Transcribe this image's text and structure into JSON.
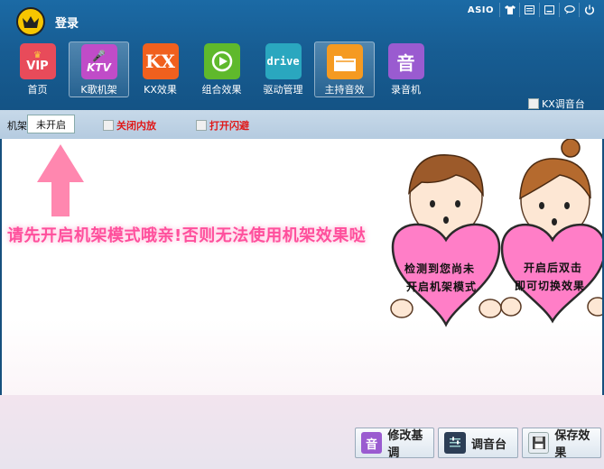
{
  "header": {
    "login_label": "登录",
    "asio_label": "ASIO"
  },
  "nav": [
    {
      "label": "首页",
      "icon": "vip-crown-icon",
      "icon_text": "VIP",
      "color": "#e84b5a"
    },
    {
      "label": "K歌机架",
      "icon": "ktv-mic-icon",
      "icon_text": "KTV",
      "color": "#c04cc8",
      "active": true
    },
    {
      "label": "KX效果",
      "icon": "kx-icon",
      "icon_text": "KX",
      "color": "#f0601e"
    },
    {
      "label": "组合效果",
      "icon": "play-combo-icon",
      "icon_text": "",
      "color": "#5fb92c"
    },
    {
      "label": "驱动管理",
      "icon": "drive-icon",
      "icon_text": "drive",
      "color": "#2aa7bf"
    },
    {
      "label": "主持音效",
      "icon": "folder-icon",
      "icon_text": "",
      "color": "#f59a21",
      "active": true
    },
    {
      "label": "录音机",
      "icon": "yin-icon",
      "icon_text": "音",
      "color": "#9a5bd0"
    }
  ],
  "kx_console_label": "KX调音台",
  "toolbar": {
    "rack_label": "机架",
    "rack_status": "未开启",
    "option1": "关闭内放",
    "option2": "打开闪避"
  },
  "notice_text": "请先开启机架模式哦亲!否则无法使用机架效果哒",
  "hearts": {
    "left": [
      "检测到您尚未",
      "开启机架模式"
    ],
    "right": [
      "开启后双击",
      "即可切换效果"
    ]
  },
  "buttons": {
    "modify_label": "修改基调",
    "modify_icon_text": "音",
    "mixer_label": "调音台",
    "save_label": "保存效果"
  },
  "colors": {
    "accent_pink": "#ff4f9c",
    "header_blue": "#1b6aa5",
    "heart_pink": "#ff7ec7"
  }
}
